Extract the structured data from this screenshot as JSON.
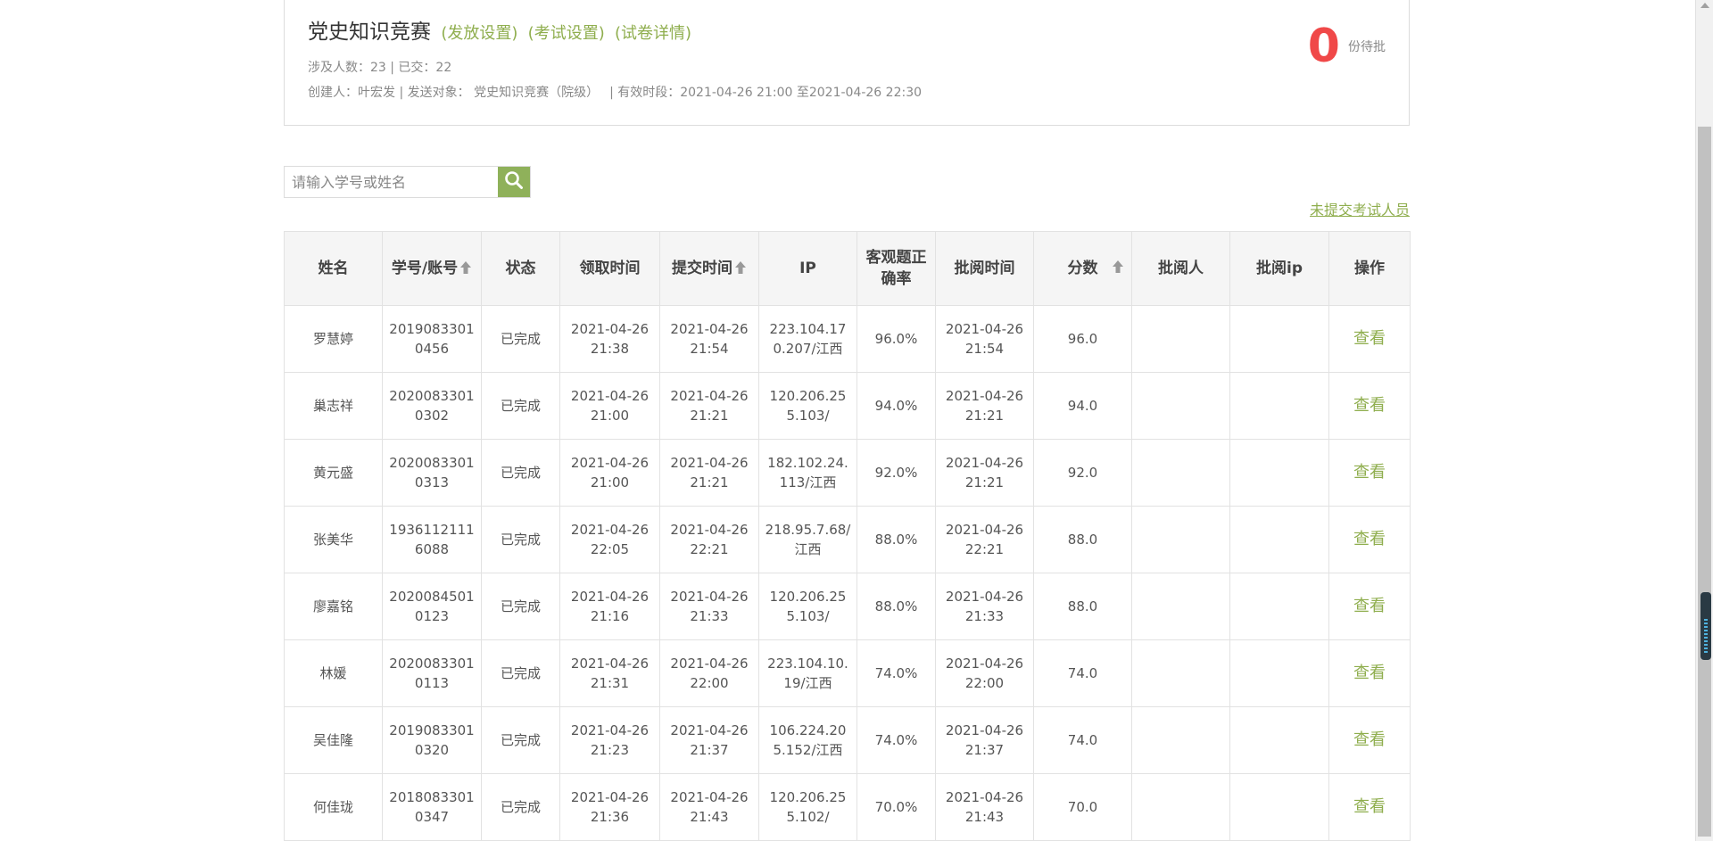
{
  "header": {
    "title": "党史知识竞赛",
    "links": [
      "(发放设置)",
      "(考试设置)",
      "(试卷详情)"
    ],
    "stats": "涉及人数：23 | 已交：22",
    "meta": "创建人：叶宏发 | 发送对象：  党史知识竞赛（院级）",
    "period": "| 有效时段：2021-04-26 21:00 至2021-04-26 22:30",
    "pending_count": "0",
    "pending_label": "份待批"
  },
  "search": {
    "placeholder": "请输入学号或姓名",
    "icon": "search-icon"
  },
  "unsubmitted_link": "未提交考试人员",
  "table": {
    "headers": [
      "姓名",
      "学号/账号",
      "状态",
      "领取时间",
      "提交时间",
      "IP",
      "客观题正确率",
      "批阅时间",
      "分数",
      "批阅人",
      "批阅ip",
      "操作"
    ],
    "sortable": [
      "学号/账号",
      "提交时间",
      "分数"
    ],
    "rows": [
      {
        "name": "罗慧婷",
        "id": "20190833010456",
        "status": "已完成",
        "received": "2021-04-26 21:38",
        "submitted": "2021-04-26 21:54",
        "ip": "223.104.170.207/江西",
        "accuracy": "96.0%",
        "reviewed": "2021-04-26 21:54",
        "score": "96.0",
        "reviewer": "",
        "reviewer_ip": "",
        "action": "查看"
      },
      {
        "name": "巢志祥",
        "id": "20200833010302",
        "status": "已完成",
        "received": "2021-04-26 21:00",
        "submitted": "2021-04-26 21:21",
        "ip": "120.206.255.103/",
        "accuracy": "94.0%",
        "reviewed": "2021-04-26 21:21",
        "score": "94.0",
        "reviewer": "",
        "reviewer_ip": "",
        "action": "查看"
      },
      {
        "name": "黄元盛",
        "id": "20200833010313",
        "status": "已完成",
        "received": "2021-04-26 21:00",
        "submitted": "2021-04-26 21:21",
        "ip": "182.102.24.113/江西",
        "accuracy": "92.0%",
        "reviewed": "2021-04-26 21:21",
        "score": "92.0",
        "reviewer": "",
        "reviewer_ip": "",
        "action": "查看"
      },
      {
        "name": "张美华",
        "id": "19361121116088",
        "status": "已完成",
        "received": "2021-04-26 22:05",
        "submitted": "2021-04-26 22:21",
        "ip": "218.95.7.68/江西",
        "accuracy": "88.0%",
        "reviewed": "2021-04-26 22:21",
        "score": "88.0",
        "reviewer": "",
        "reviewer_ip": "",
        "action": "查看"
      },
      {
        "name": "廖嘉铭",
        "id": "20200845010123",
        "status": "已完成",
        "received": "2021-04-26 21:16",
        "submitted": "2021-04-26 21:33",
        "ip": "120.206.255.103/",
        "accuracy": "88.0%",
        "reviewed": "2021-04-26 21:33",
        "score": "88.0",
        "reviewer": "",
        "reviewer_ip": "",
        "action": "查看"
      },
      {
        "name": "林媛",
        "id": "20200833010113",
        "status": "已完成",
        "received": "2021-04-26 21:31",
        "submitted": "2021-04-26 22:00",
        "ip": "223.104.10.19/江西",
        "accuracy": "74.0%",
        "reviewed": "2021-04-26 22:00",
        "score": "74.0",
        "reviewer": "",
        "reviewer_ip": "",
        "action": "查看"
      },
      {
        "name": "吴佳隆",
        "id": "20190833010320",
        "status": "已完成",
        "received": "2021-04-26 21:23",
        "submitted": "2021-04-26 21:37",
        "ip": "106.224.205.152/江西",
        "accuracy": "74.0%",
        "reviewed": "2021-04-26 21:37",
        "score": "74.0",
        "reviewer": "",
        "reviewer_ip": "",
        "action": "查看"
      },
      {
        "name": "何佳珑",
        "id": "20180833010347",
        "status": "已完成",
        "received": "2021-04-26 21:36",
        "submitted": "2021-04-26 21:43",
        "ip": "120.206.255.102/",
        "accuracy": "70.0%",
        "reviewed": "2021-04-26 21:43",
        "score": "70.0",
        "reviewer": "",
        "reviewer_ip": "",
        "action": "查看"
      }
    ]
  },
  "colors": {
    "accent_green": "#8fae4e",
    "pending_red": "#f04848",
    "header_bg": "#f5f5f5"
  }
}
